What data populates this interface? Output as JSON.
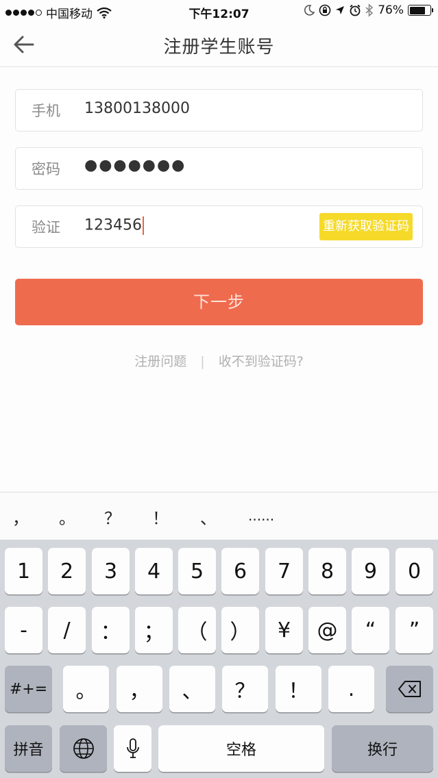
{
  "status_bar": {
    "carrier": "中国移动",
    "time": "下午12:07",
    "battery": "76%",
    "battery_level": 0.76
  },
  "nav": {
    "title": "注册学生账号",
    "back_icon": "arrow-left-icon"
  },
  "form": {
    "phone": {
      "label": "手机",
      "value": "13800138000"
    },
    "password": {
      "label": "密码",
      "value": "●●●●●●●"
    },
    "code": {
      "label": "验证",
      "value": "123456",
      "resend_label": "重新获取验证码"
    }
  },
  "next_button": "下一步",
  "help_links": {
    "problem": "注册问题",
    "separator": "|",
    "no_code": "收不到验证码?"
  },
  "keyboard": {
    "suggestions": [
      "，",
      "。",
      "？",
      "！",
      "、",
      "......"
    ],
    "row1": [
      "1",
      "2",
      "3",
      "4",
      "5",
      "6",
      "7",
      "8",
      "9",
      "0"
    ],
    "row2": [
      "-",
      "/",
      "：",
      "；",
      "（",
      "）",
      "¥",
      "@",
      "“",
      "”"
    ],
    "row3_mode": "#+=",
    "row3": [
      "。",
      "，",
      "、",
      "？",
      "！",
      "."
    ],
    "row4": {
      "pinyin": "拼音",
      "space": "空格",
      "return": "换行"
    }
  },
  "colors": {
    "accent": "#ef6b4e",
    "resend": "#f5da2a"
  }
}
